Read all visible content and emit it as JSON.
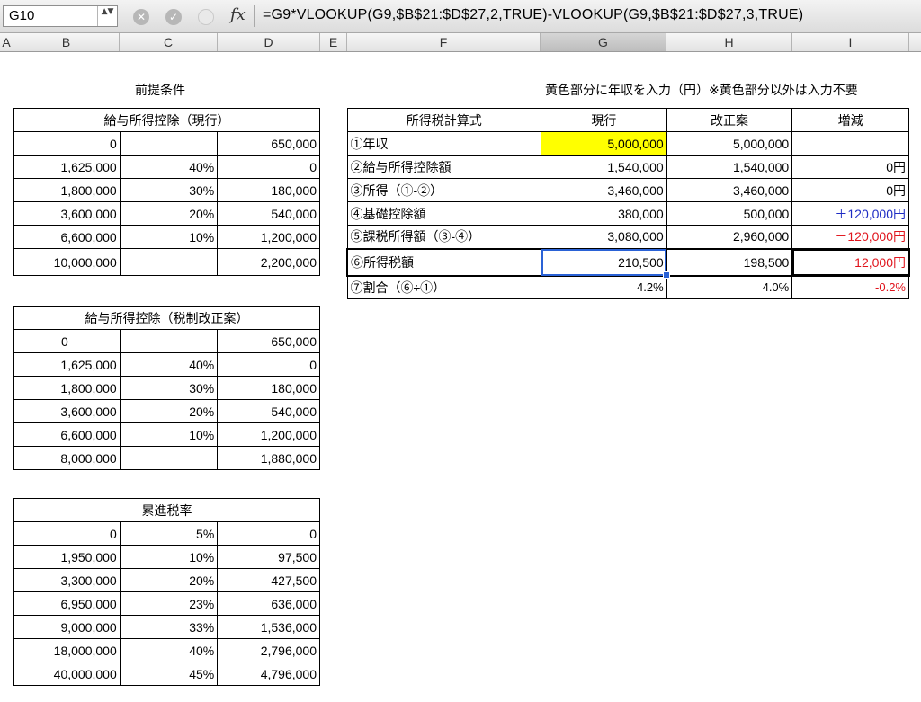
{
  "formula_bar": {
    "name_box": "G10",
    "formula": "=G9*VLOOKUP(G9,$B$21:$D$27,2,TRUE)-VLOOKUP(G9,$B$21:$D$27,3,TRUE)",
    "fx_label": "fx",
    "cancel_glyph": "✕",
    "enter_glyph": "✓",
    "stepper_glyph": "▲▼"
  },
  "columns": [
    "A",
    "B",
    "C",
    "D",
    "E",
    "F",
    "G",
    "H",
    "I"
  ],
  "labels": {
    "premise": "前提条件",
    "note": "黄色部分に年収を入力（円）※黄色部分以外は入力不要"
  },
  "table_current": {
    "title": "給与所得控除（現行）",
    "rows": [
      [
        "0",
        "",
        "650,000"
      ],
      [
        "1,625,000",
        "40%",
        "0"
      ],
      [
        "1,800,000",
        "30%",
        "180,000"
      ],
      [
        "3,600,000",
        "20%",
        "540,000"
      ],
      [
        "6,600,000",
        "10%",
        "1,200,000"
      ],
      [
        "10,000,000",
        "",
        "2,200,000"
      ]
    ]
  },
  "table_reform": {
    "title": "給与所得控除（税制改正案）",
    "rows": [
      [
        "0",
        "",
        "650,000"
      ],
      [
        "1,625,000",
        "40%",
        "0"
      ],
      [
        "1,800,000",
        "30%",
        "180,000"
      ],
      [
        "3,600,000",
        "20%",
        "540,000"
      ],
      [
        "6,600,000",
        "10%",
        "1,200,000"
      ],
      [
        "8,000,000",
        "",
        "1,880,000"
      ]
    ]
  },
  "table_progressive": {
    "title": "累進税率",
    "rows": [
      [
        "0",
        "5%",
        "0"
      ],
      [
        "1,950,000",
        "10%",
        "97,500"
      ],
      [
        "3,300,000",
        "20%",
        "427,500"
      ],
      [
        "6,950,000",
        "23%",
        "636,000"
      ],
      [
        "9,000,000",
        "33%",
        "1,536,000"
      ],
      [
        "18,000,000",
        "40%",
        "2,796,000"
      ],
      [
        "40,000,000",
        "45%",
        "4,796,000"
      ]
    ]
  },
  "calc_table": {
    "headers": [
      "所得税計算式",
      "現行",
      "改正案",
      "増減"
    ],
    "rows": [
      [
        "①年収",
        "5,000,000",
        "5,000,000",
        ""
      ],
      [
        "②給与所得控除額",
        "1,540,000",
        "1,540,000",
        "0円"
      ],
      [
        "③所得（①-②）",
        "3,460,000",
        "3,460,000",
        "0円"
      ],
      [
        "④基礎控除額",
        "380,000",
        "500,000",
        "＋120,000円"
      ],
      [
        "⑤課税所得額（③-④）",
        "3,080,000",
        "2,960,000",
        "－120,000円"
      ],
      [
        "⑥所得税額",
        "210,500",
        "198,500",
        "－12,000円"
      ],
      [
        "⑦割合（⑥÷①）",
        "4.2%",
        "4.0%",
        "-0.2%"
      ]
    ]
  },
  "colors": {
    "input_highlight": "#ffff00",
    "positive": "#1e2cc4",
    "negative": "#e0141c",
    "selection": "#2a62d6"
  }
}
